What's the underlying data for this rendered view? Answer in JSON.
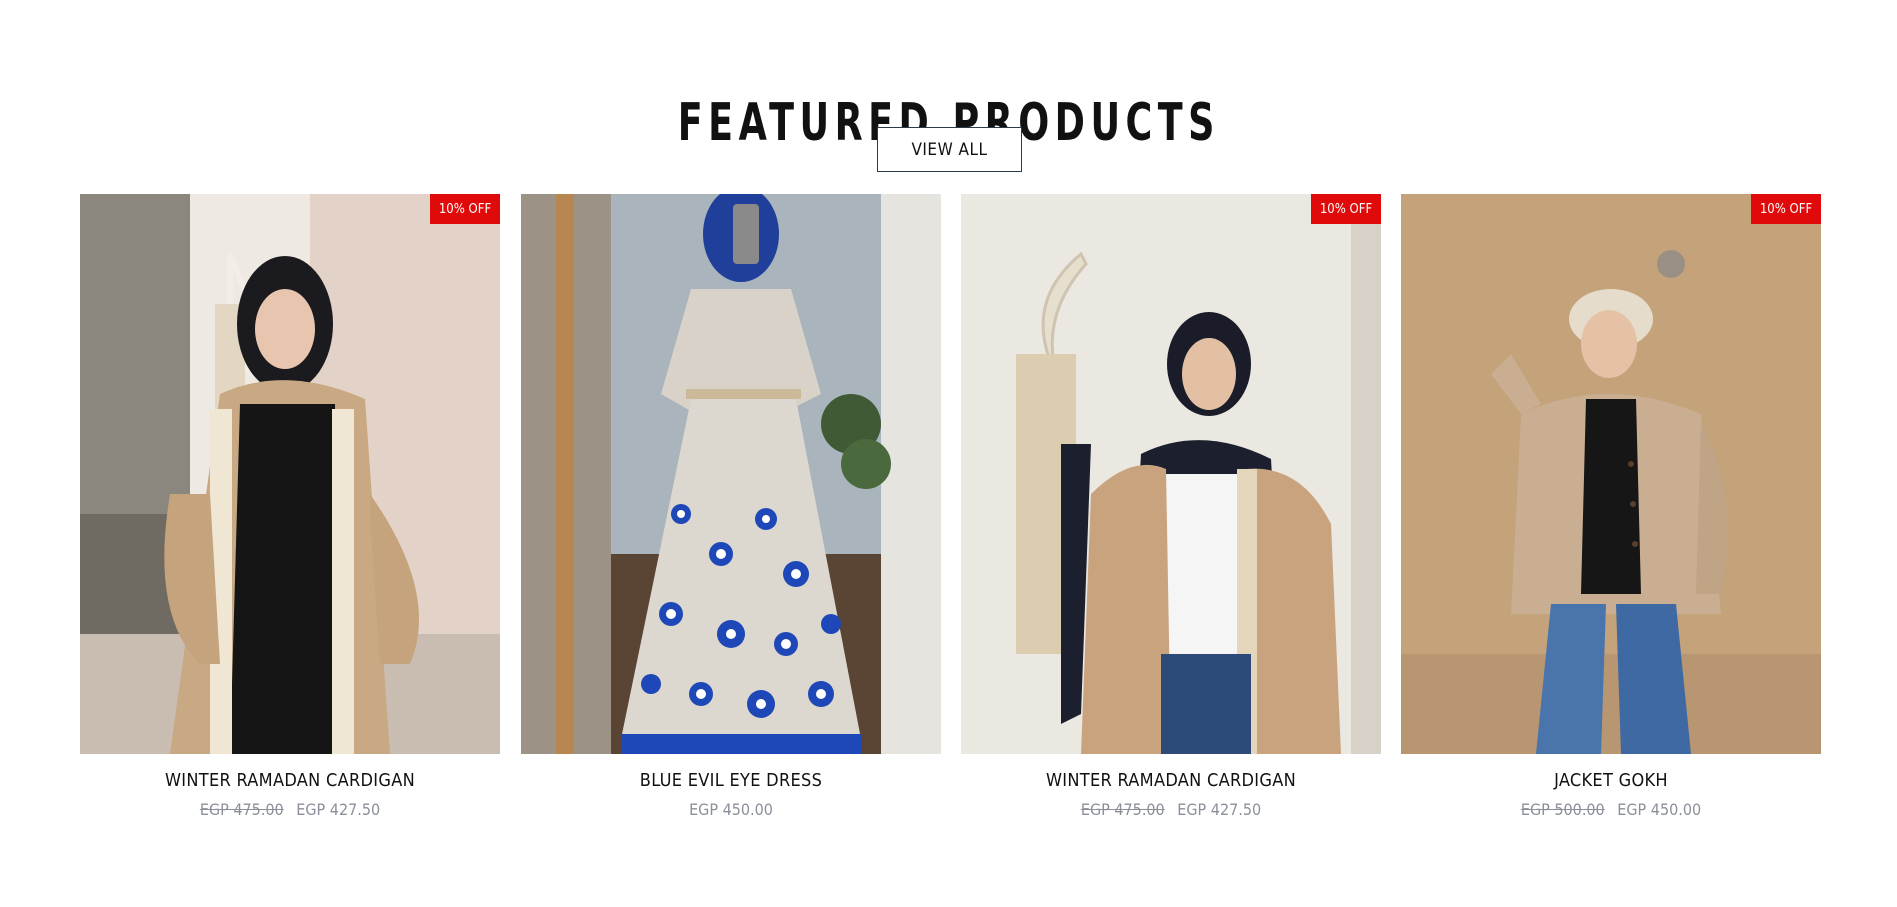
{
  "section": {
    "title": "FEATURED PRODUCTS",
    "view_all_label": "VIEW ALL"
  },
  "products": [
    {
      "title": "WINTER RAMADAN CARDIGAN",
      "badge": "10% OFF",
      "price_old": "EGP 475.00",
      "price_new": "EGP 427.50"
    },
    {
      "title": "BLUE EVIL EYE DRESS",
      "badge": "",
      "price_old": "",
      "price_new": "EGP 450.00"
    },
    {
      "title": "WINTER RAMADAN CARDIGAN",
      "badge": "10% OFF",
      "price_old": "EGP 475.00",
      "price_new": "EGP 427.50"
    },
    {
      "title": "JACKET GOKH",
      "badge": "10% OFF",
      "price_old": "EGP 500.00",
      "price_new": "EGP 450.00"
    }
  ],
  "colors": {
    "badge": "#e00a0a",
    "price": "#8a8f9a",
    "title": "#111111"
  }
}
